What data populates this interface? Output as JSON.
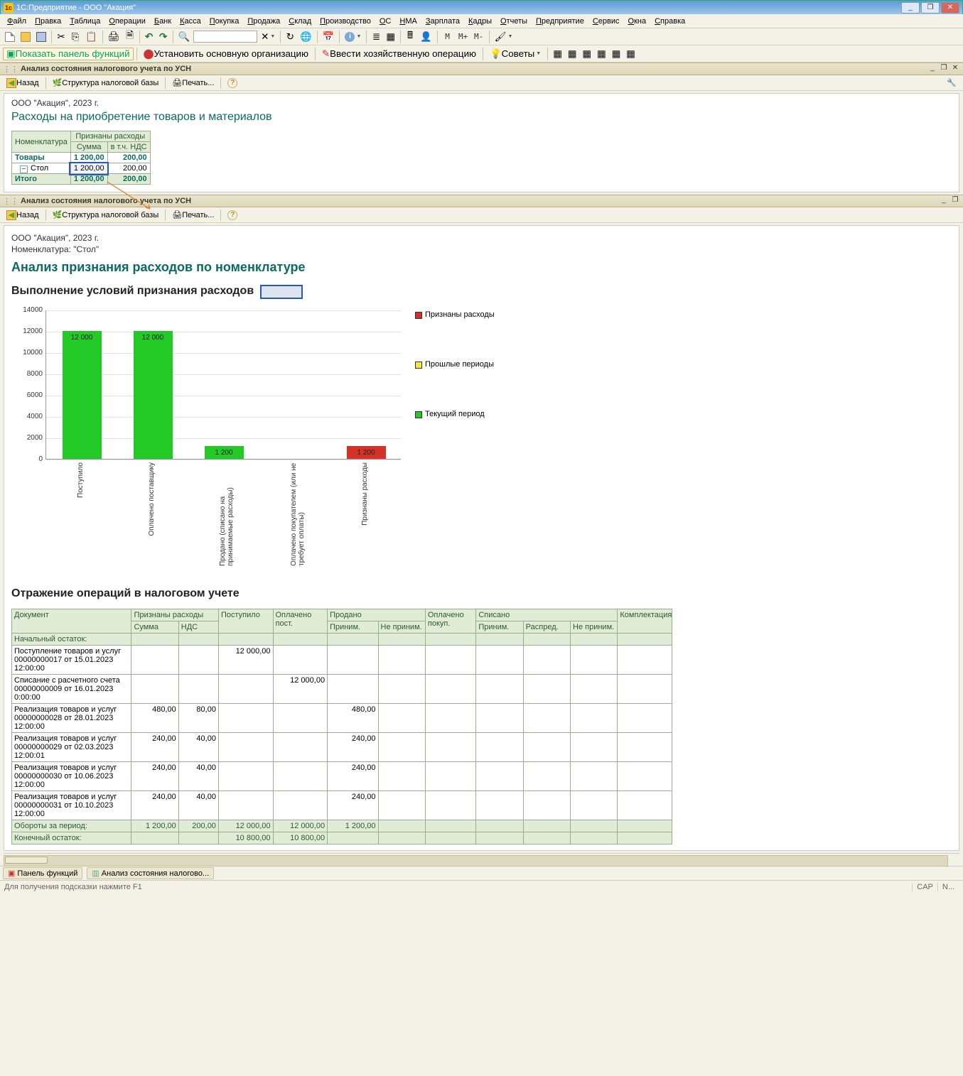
{
  "title_bar": {
    "text": "1С:Предприятие - ООО \"Акация\"",
    "min": "_",
    "restore": "❐",
    "close": "✕"
  },
  "menu": [
    "Файл",
    "Правка",
    "Таблица",
    "Операции",
    "Банк",
    "Касса",
    "Покупка",
    "Продажа",
    "Склад",
    "Производство",
    "ОС",
    "НМА",
    "Зарплата",
    "Кадры",
    "Отчеты",
    "Предприятие",
    "Сервис",
    "Окна",
    "Справка"
  ],
  "toolbar1": {
    "m": "M",
    "m_plus": "M+",
    "m_minus": "M-"
  },
  "toolbar2": {
    "panel_fn": "Показать панель функций",
    "set_main_org": "Установить основную организацию",
    "enter_op": "Ввести хозяйственную операцию",
    "tips": "Советы"
  },
  "doc_tab1": {
    "title": "Анализ состояния налогового учета по УСН"
  },
  "nav1": {
    "back": "Назад",
    "struct": "Структура налоговой базы",
    "print": "Печать..."
  },
  "report1": {
    "org": "ООО \"Акация\", 2023 г.",
    "heading": "Расходы на приобретение товаров и материалов",
    "headers": {
      "nomenclature": "Номенклатура",
      "expenses": "Признаны расходы",
      "sum": "Сумма",
      "vat": "в т.ч. НДС"
    },
    "cat_row": {
      "name": "Товары",
      "sum": "1 200,00",
      "vat": "200,00"
    },
    "item_row": {
      "name": "Стол",
      "sum": "1 200,00",
      "vat": "200,00"
    },
    "total_row": {
      "name": "Итого",
      "sum": "1 200,00",
      "vat": "200,00"
    }
  },
  "doc_tab2": {
    "title": "Анализ состояния налогового учета по УСН"
  },
  "nav2": {
    "back": "Назад",
    "struct": "Структура налоговой базы",
    "print": "Печать..."
  },
  "report2": {
    "org": "ООО \"Акация\", 2023 г.",
    "nomen": "Номенклатура: \"Стол\"",
    "heading": "Анализ признания расходов по номенклатуре",
    "subheading": "Выполнение условий признания расходов",
    "ops_heading": "Отражение операций в налоговом учете"
  },
  "chart_data": {
    "type": "bar",
    "ylim": [
      0,
      14000
    ],
    "yticks": [
      0,
      2000,
      4000,
      6000,
      8000,
      10000,
      12000,
      14000
    ],
    "categories": [
      "Поступило",
      "Оплачено поставщику",
      "Продано (списано на принимаемые расходы)",
      "Оплачено покупателем (или не требует оплаты)",
      "Признаны расходы"
    ],
    "series": [
      {
        "name": "Текущий период",
        "color": "green",
        "values": [
          12000,
          12000,
          1200,
          0,
          0
        ],
        "labels": [
          "12 000",
          "12 000",
          "1 200",
          "",
          ""
        ]
      },
      {
        "name": "Признаны расходы",
        "color": "red",
        "values": [
          0,
          0,
          0,
          0,
          1200
        ],
        "labels": [
          "",
          "",
          "",
          "",
          "1 200"
        ]
      }
    ],
    "legend": [
      {
        "label": "Признаны расходы",
        "color": "red"
      },
      {
        "label": "Прошлые периоды",
        "color": "yellow"
      },
      {
        "label": "Текущий период",
        "color": "green"
      }
    ]
  },
  "ops_table": {
    "headers": {
      "doc": "Документ",
      "exp": "Признаны расходы",
      "sum": "Сумма",
      "vat": "НДС",
      "received": "Поступило",
      "paid_supp": "Оплачено пост.",
      "sold": "Продано",
      "accept": "Приним.",
      "not_accept": "Не приним.",
      "paid_cust": "Оплачено покуп.",
      "written": "Списано",
      "accept2": "Приним.",
      "distr": "Распред.",
      "not_accept2": "Не приним.",
      "compl": "Комплектация"
    },
    "start_balance": "Начальный остаток:",
    "rows": [
      {
        "doc": "Поступление товаров и услуг 00000000017 от 15.01.2023 12:00:00",
        "sum": "",
        "vat": "",
        "received": "12 000,00",
        "paid": "",
        "sold_a": "",
        "sold_n": "",
        "paidc": "",
        "wr_a": "",
        "wr_d": "",
        "wr_n": "",
        "compl": ""
      },
      {
        "doc": "Списание с расчетного счета 00000000009 от 16.01.2023 0:00:00",
        "sum": "",
        "vat": "",
        "received": "",
        "paid": "12 000,00",
        "sold_a": "",
        "sold_n": "",
        "paidc": "",
        "wr_a": "",
        "wr_d": "",
        "wr_n": "",
        "compl": ""
      },
      {
        "doc": "Реализация товаров и услуг 00000000028 от 28.01.2023 12:00:00",
        "sum": "480,00",
        "vat": "80,00",
        "received": "",
        "paid": "",
        "sold_a": "480,00",
        "sold_n": "",
        "paidc": "",
        "wr_a": "",
        "wr_d": "",
        "wr_n": "",
        "compl": ""
      },
      {
        "doc": "Реализация товаров и услуг 00000000029 от 02.03.2023 12:00:01",
        "sum": "240,00",
        "vat": "40,00",
        "received": "",
        "paid": "",
        "sold_a": "240,00",
        "sold_n": "",
        "paidc": "",
        "wr_a": "",
        "wr_d": "",
        "wr_n": "",
        "compl": ""
      },
      {
        "doc": "Реализация товаров и услуг 00000000030 от 10.06.2023 12:00:00",
        "sum": "240,00",
        "vat": "40,00",
        "received": "",
        "paid": "",
        "sold_a": "240,00",
        "sold_n": "",
        "paidc": "",
        "wr_a": "",
        "wr_d": "",
        "wr_n": "",
        "compl": ""
      },
      {
        "doc": "Реализация товаров и услуг 00000000031 от 10.10.2023 12:00:00",
        "sum": "240,00",
        "vat": "40,00",
        "received": "",
        "paid": "",
        "sold_a": "240,00",
        "sold_n": "",
        "paidc": "",
        "wr_a": "",
        "wr_d": "",
        "wr_n": "",
        "compl": ""
      }
    ],
    "turnover_label": "Обороты за период:",
    "turnover": {
      "sum": "1 200,00",
      "vat": "200,00",
      "received": "12 000,00",
      "paid": "12 000,00",
      "sold_a": "1 200,00"
    },
    "end_balance_label": "Конечный остаток:",
    "end_balance": {
      "received": "10 800,00",
      "paid": "10 800,00"
    }
  },
  "bottom_tabs": {
    "t1": "Панель функций",
    "t2": "Анализ состояния налогово..."
  },
  "status": {
    "hint": "Для получения подсказки нажмите F1",
    "cap": "CAP",
    "num": "N..."
  }
}
